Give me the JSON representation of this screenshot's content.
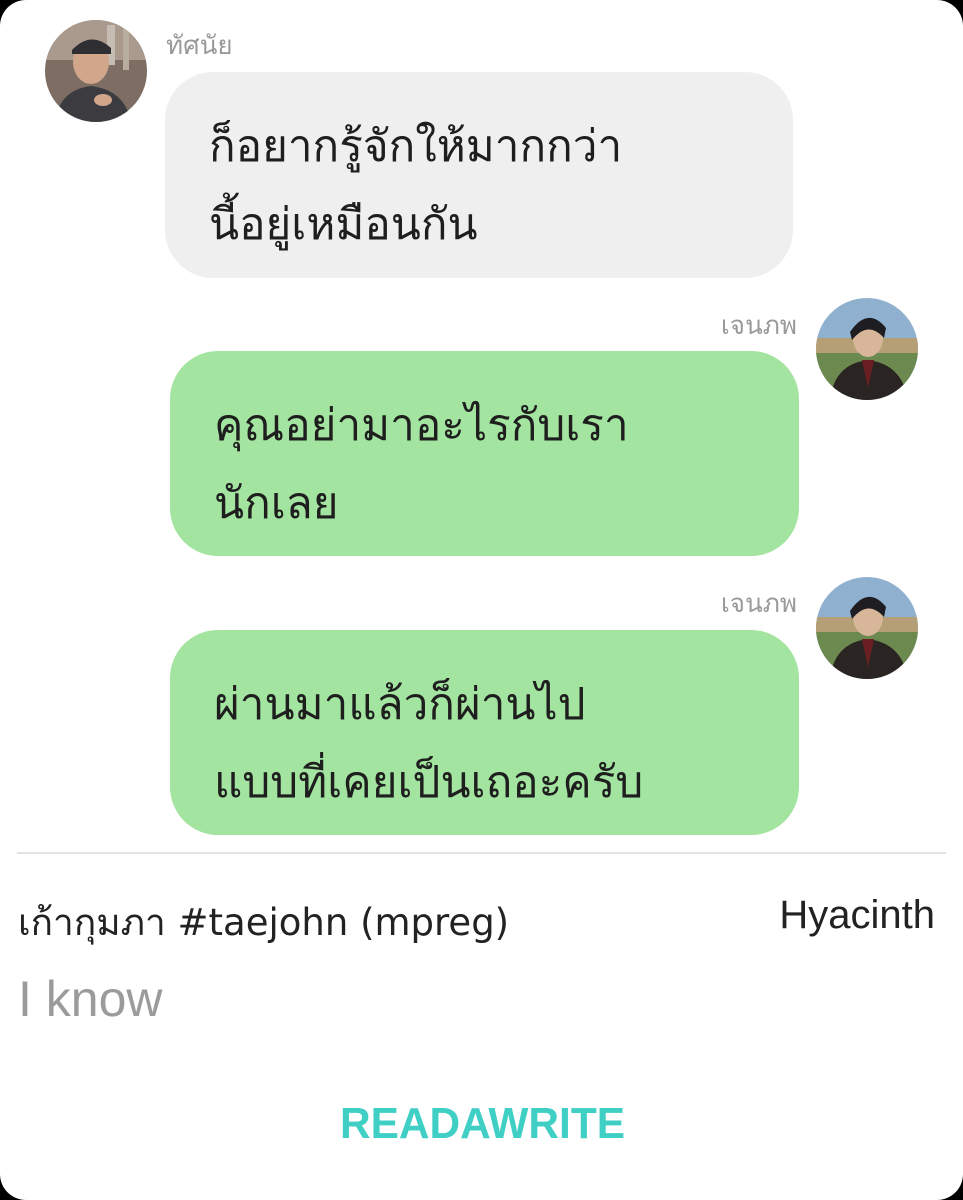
{
  "messages": [
    {
      "sender": "ทัศนัย",
      "side": "incoming",
      "lines": [
        "ก็อยากรู้จักให้มากกว่า",
        "นี้อยู่เหมือนกัน"
      ]
    },
    {
      "sender": "เจนภพ",
      "side": "outgoing",
      "lines": [
        "คุณอย่ามาอะไรกับเรา",
        "นักเลย"
      ]
    },
    {
      "sender": "เจนภพ",
      "side": "outgoing",
      "lines": [
        "ผ่านมาแล้วก็ผ่านไป",
        "แบบที่เคยเป็นเถอะครับ"
      ]
    }
  ],
  "footer": {
    "story_title": "เก้ากุมภา #taejohn (mpreg)",
    "author": "Hyacinth",
    "chapter_title": "I know"
  },
  "logo": {
    "text": "READAWRITE",
    "color": "#3fcfc4"
  },
  "colors": {
    "incoming_bubble": "#efefef",
    "outgoing_bubble": "#a3e4a0",
    "sender_name": "#9a9a9a",
    "chapter_title": "#9b9b9b"
  },
  "icons": {
    "avatar_incoming": "user-avatar-photo",
    "avatar_outgoing": "user-avatar-photo"
  }
}
